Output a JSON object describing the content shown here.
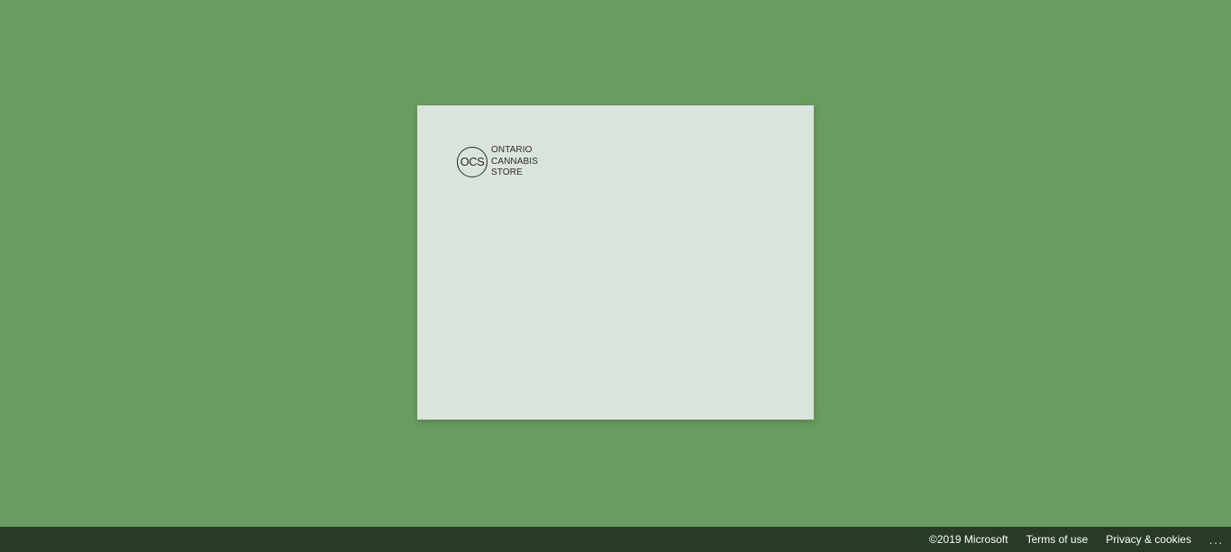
{
  "colors": {
    "page_background": "#699c5f",
    "card_background": "#dae4da",
    "footer_background": "#273b26",
    "text_dark": "#2a2a2a",
    "footer_text": "#ffffff"
  },
  "logo": {
    "monogram": "OCS",
    "lines": [
      "ONTARIO",
      "CANNABIS",
      "STORE"
    ]
  },
  "footer": {
    "copyright": "©2019 Microsoft",
    "terms_label": "Terms of use",
    "privacy_label": "Privacy & cookies",
    "more_label": "..."
  }
}
